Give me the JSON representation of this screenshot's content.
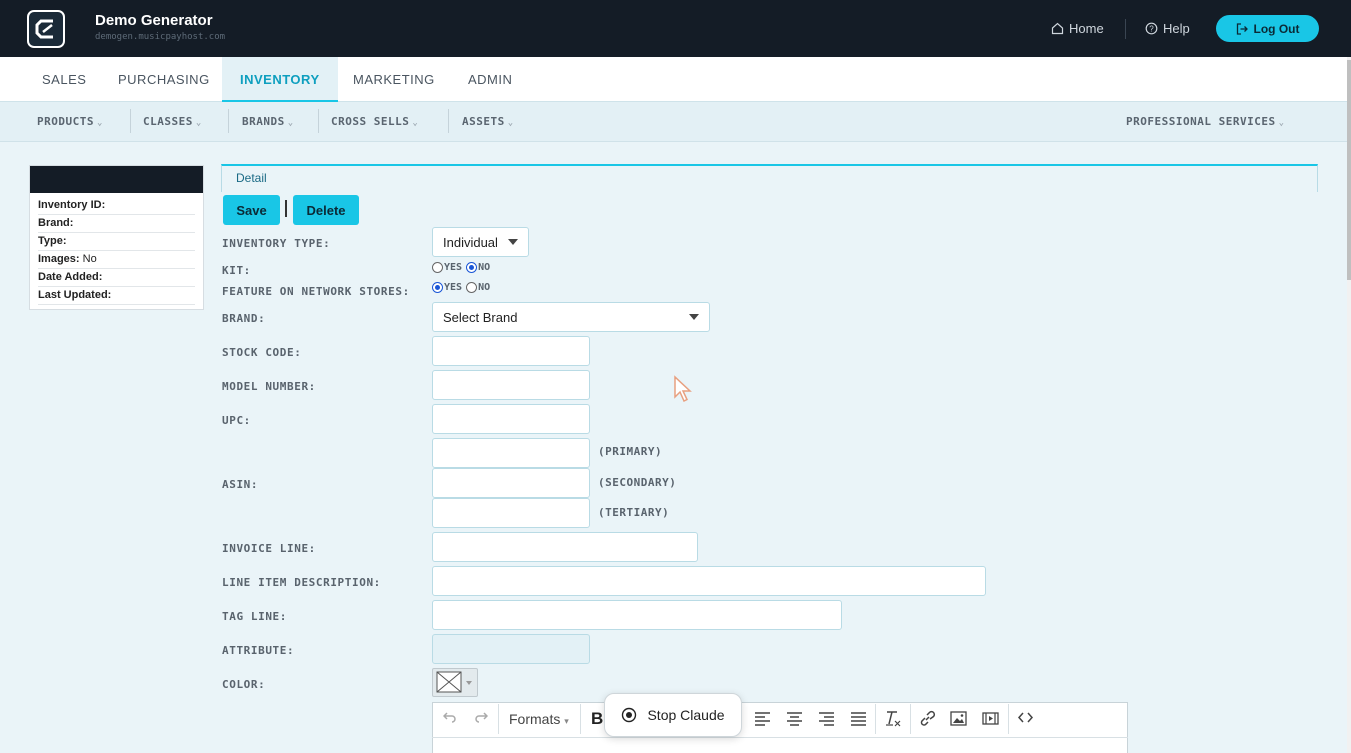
{
  "header": {
    "title": "Demo Generator",
    "subtitle": "demogen.musicpayhost.com",
    "home": "Home",
    "help": "Help",
    "logout": "Log Out"
  },
  "tabs": [
    "SALES",
    "PURCHASING",
    "INVENTORY",
    "MARKETING",
    "ADMIN"
  ],
  "active_tab": "INVENTORY",
  "subnav": {
    "products": "PRODUCTS",
    "classes": "CLASSES",
    "brands": "BRANDS",
    "cross_sells": "CROSS SELLS",
    "assets": "ASSETS",
    "professional": "PROFESSIONAL SERVICES"
  },
  "info": {
    "inventory_id": "Inventory ID:",
    "brand": "Brand:",
    "type": "Type:",
    "images": "Images:",
    "images_value": "No",
    "date_added": "Date Added:",
    "last_updated": "Last Updated:"
  },
  "detail": {
    "tab": "Detail",
    "save": "Save",
    "delete": "Delete"
  },
  "form": {
    "inventory_type": {
      "label": "INVENTORY TYPE:",
      "value": "Individual"
    },
    "kit": {
      "label": "KIT:",
      "yes": "YES",
      "no": "NO",
      "selected": "NO"
    },
    "feature": {
      "label": "FEATURE ON NETWORK STORES:",
      "yes": "YES",
      "no": "NO",
      "selected": "YES"
    },
    "brand": {
      "label": "BRAND:",
      "value": "Select Brand"
    },
    "stock_code": {
      "label": "STOCK CODE:"
    },
    "model_number": {
      "label": "MODEL NUMBER:"
    },
    "upc": {
      "label": "UPC:"
    },
    "asin": {
      "label": "ASIN:",
      "primary": "(PRIMARY)",
      "secondary": "(SECONDARY)",
      "tertiary": "(TERTIARY)"
    },
    "invoice_line": {
      "label": "INVOICE LINE:"
    },
    "line_item_description": {
      "label": "LINE ITEM DESCRIPTION:"
    },
    "tag_line": {
      "label": "TAG LINE:"
    },
    "attribute": {
      "label": "ATTRIBUTE:"
    },
    "color": {
      "label": "COLOR:"
    }
  },
  "editor": {
    "formats": "Formats",
    "bold": "B"
  },
  "overlay": {
    "stop": "Stop Claude"
  },
  "colors": {
    "accent": "#19c6e6",
    "header_bg": "#141c26"
  }
}
